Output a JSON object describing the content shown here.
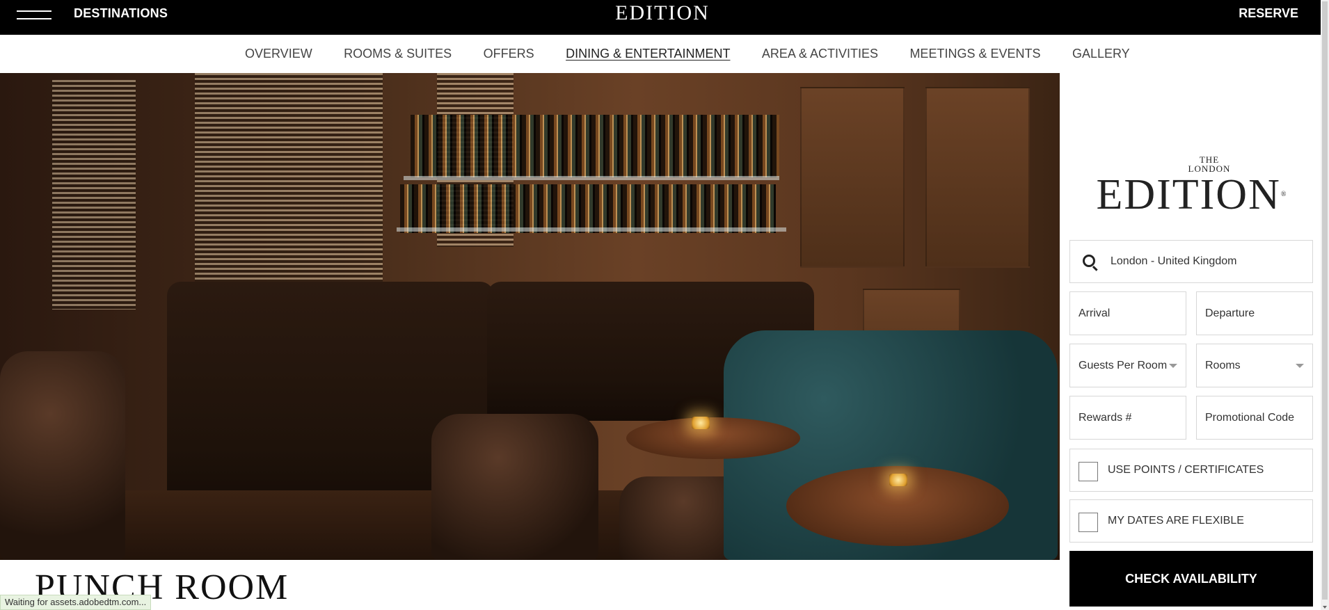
{
  "header": {
    "destinations_label": "DESTINATIONS",
    "brand": "EDITION",
    "reserve_label": "RESERVE"
  },
  "nav": {
    "items": [
      {
        "label": "OVERVIEW",
        "active": false
      },
      {
        "label": "ROOMS & SUITES",
        "active": false
      },
      {
        "label": "OFFERS",
        "active": false
      },
      {
        "label": "DINING & ENTERTAINMENT",
        "active": true
      },
      {
        "label": "AREA & ACTIVITIES",
        "active": false
      },
      {
        "label": "MEETINGS & EVENTS",
        "active": false
      },
      {
        "label": "GALLERY",
        "active": false
      }
    ]
  },
  "main": {
    "title": "PUNCH ROOM"
  },
  "booking": {
    "logo_top": "THE",
    "logo_sub": "LONDON",
    "logo_main": "EDITION",
    "logo_reg": "®",
    "location": "London - United Kingdom",
    "arrival_placeholder": "Arrival",
    "departure_placeholder": "Departure",
    "guests_label": "Guests Per Room",
    "rooms_label": "Rooms",
    "rewards_placeholder": "Rewards #",
    "promo_placeholder": "Promotional Code",
    "use_points_label": "USE POINTS / CERTIFICATES",
    "flexible_label": "MY DATES ARE FLEXIBLE",
    "check_button": "CHECK AVAILABILITY"
  },
  "status_bar": "Waiting for assets.adobedtm.com...",
  "colors": {
    "topbar": "#000000",
    "button": "#000000",
    "status_bg": "#e8f3e1"
  }
}
